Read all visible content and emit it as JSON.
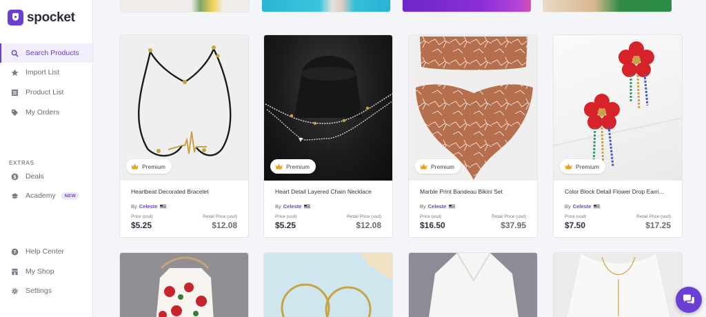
{
  "app": {
    "logo_text": "spocket",
    "brand_color": "#6b3fd4"
  },
  "sidebar": {
    "nav": [
      {
        "label": "Search Products",
        "icon": "search-icon",
        "active": true
      },
      {
        "label": "Import List",
        "icon": "star-icon"
      },
      {
        "label": "Product List",
        "icon": "list-icon"
      },
      {
        "label": "My Orders",
        "icon": "tag-icon"
      }
    ],
    "extras_label": "EXTRAS",
    "extras": [
      {
        "label": "Deals",
        "icon": "deals-icon"
      },
      {
        "label": "Academy",
        "icon": "academy-icon",
        "badge": "NEW"
      }
    ],
    "bottom": [
      {
        "label": "Help Center",
        "icon": "help-icon"
      },
      {
        "label": "My Shop",
        "icon": "shop-icon"
      },
      {
        "label": "Settings",
        "icon": "gear-icon"
      }
    ]
  },
  "products": [
    {
      "name": "Heartbeat Decorated Bracelet",
      "badge": "Premium",
      "by_label": "By",
      "seller": "Celeste",
      "price_label": "Price (usd)",
      "price": "$5.25",
      "retail_label": "Retail Price (usd)",
      "retail": "$12.08"
    },
    {
      "name": "Heart Detail Layered Chain Necklace",
      "badge": "Premium",
      "by_label": "By",
      "seller": "Celeste",
      "price_label": "Price (usd)",
      "price": "$5.25",
      "retail_label": "Retail Price (usd)",
      "retail": "$12.08"
    },
    {
      "name": "Marble Print Bandeau Bikini Set",
      "badge": "Premium",
      "by_label": "By",
      "seller": "Celeste",
      "price_label": "Price (usd)",
      "price": "$16.50",
      "retail_label": "Retail Price (usd)",
      "retail": "$37.95"
    },
    {
      "name": "Color Block Detail Flower Drop Earri...",
      "badge": "Premium",
      "by_label": "By",
      "seller": "Celeste",
      "price_label": "Price (usd)",
      "price": "$7.50",
      "retail_label": "Retail Price (usd)",
      "retail": "$17.25"
    }
  ],
  "chat": {
    "icon": "chat-icon"
  }
}
